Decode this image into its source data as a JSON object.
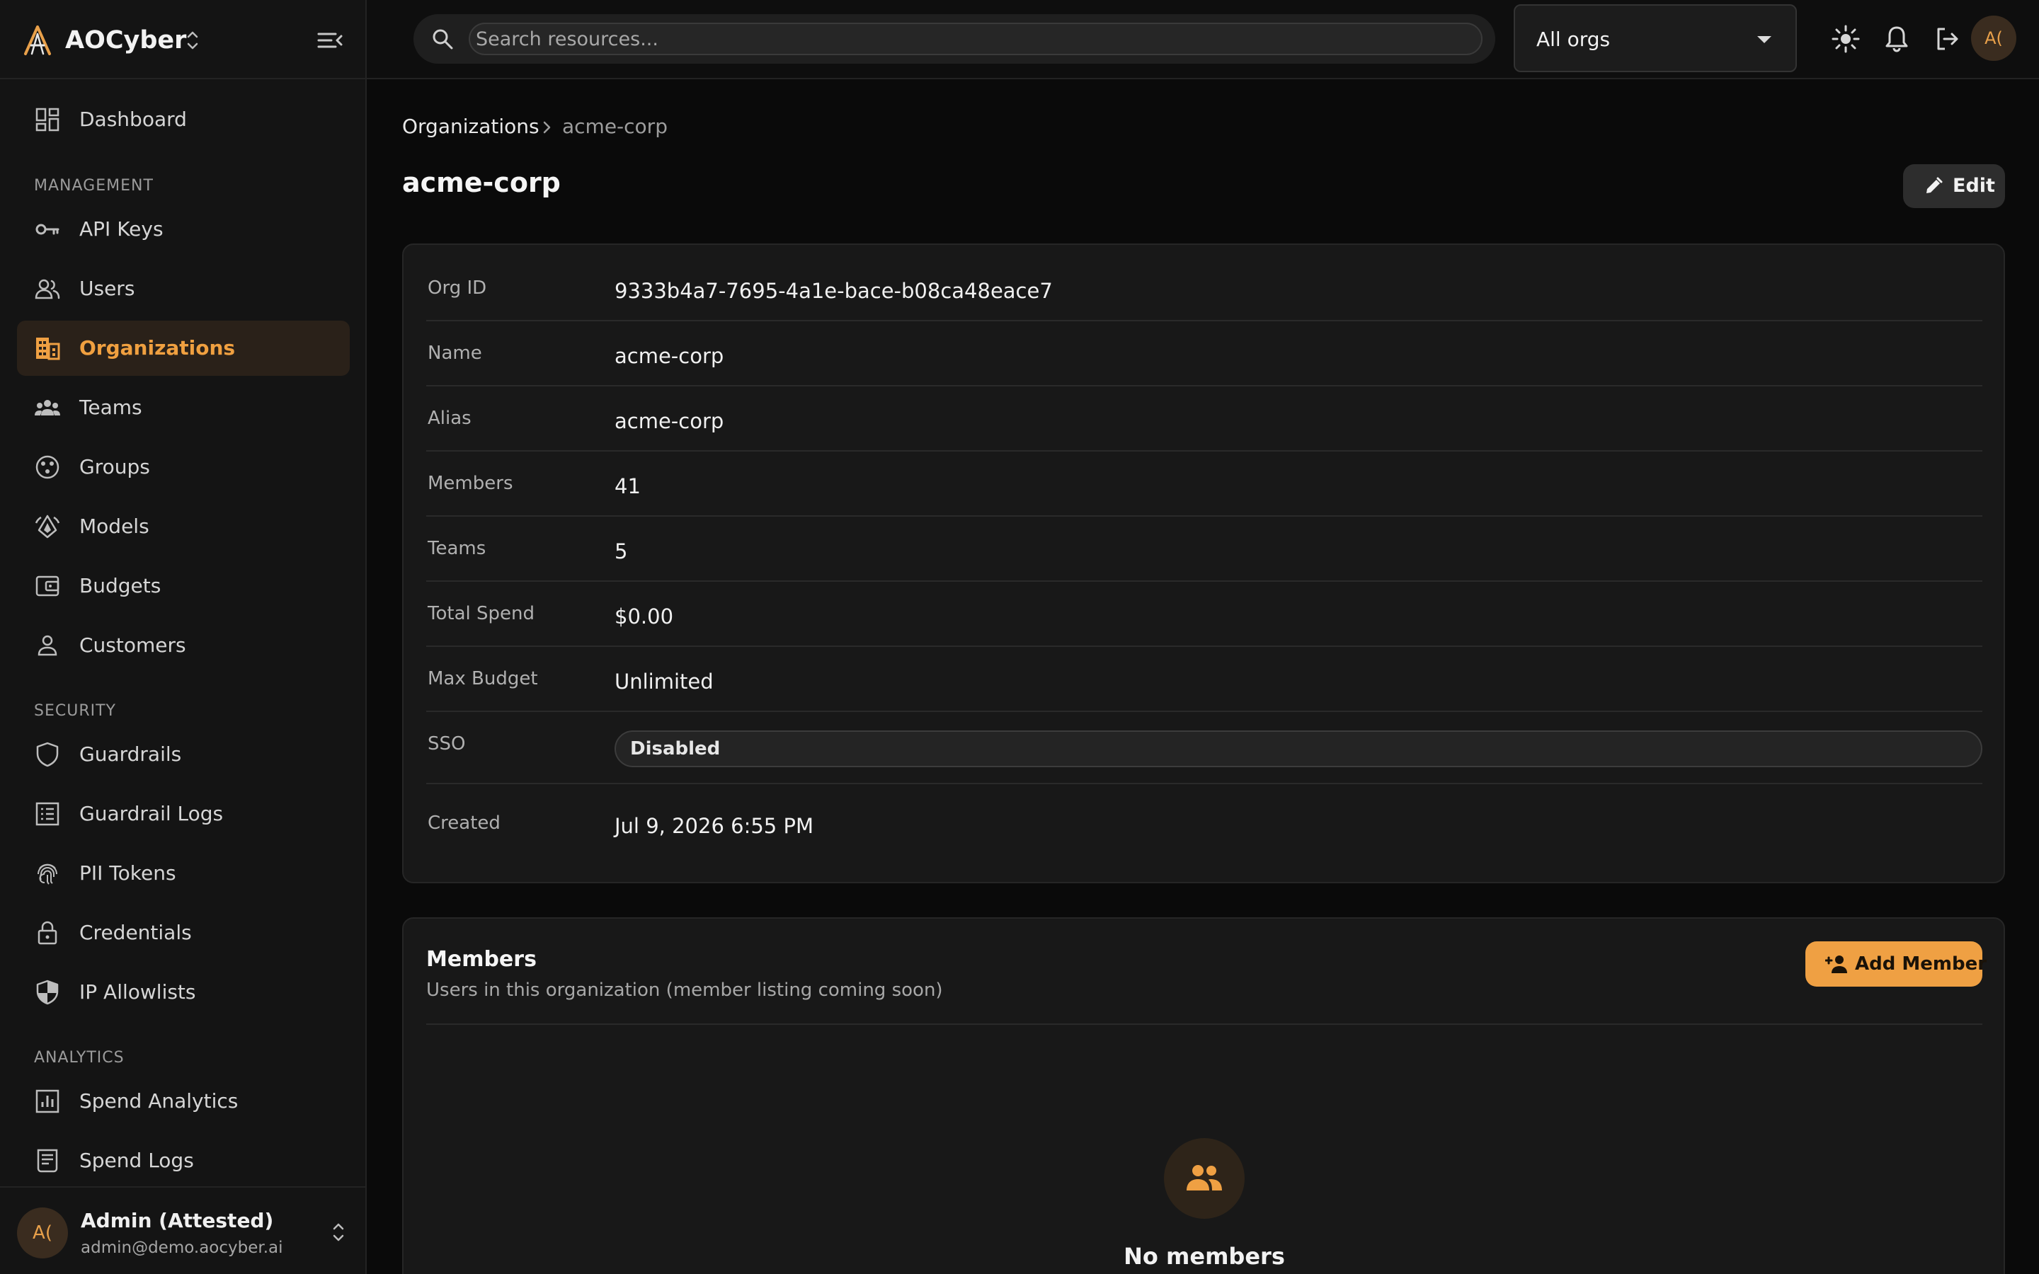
{
  "brand": {
    "name": "AOCyber"
  },
  "sidebar": {
    "dashboard": "Dashboard",
    "sections": {
      "management": "MANAGEMENT",
      "security": "SECURITY",
      "analytics": "ANALYTICS"
    },
    "items": {
      "api_keys": "API Keys",
      "users": "Users",
      "organizations": "Organizations",
      "teams": "Teams",
      "groups": "Groups",
      "models": "Models",
      "budgets": "Budgets",
      "customers": "Customers",
      "guardrails": "Guardrails",
      "guardrail_logs": "Guardrail Logs",
      "pii_tokens": "PII Tokens",
      "credentials": "Credentials",
      "ip_allowlists": "IP Allowlists",
      "spend_analytics": "Spend Analytics",
      "spend_logs": "Spend Logs"
    },
    "active": "organizations"
  },
  "user": {
    "initials": "A(",
    "name": "Admin (Attested)",
    "email": "admin@demo.aocyber.ai"
  },
  "header": {
    "search_placeholder": "Search resources...",
    "org_select": "All orgs",
    "avatar_initials": "A("
  },
  "breadcrumb": {
    "parent": "Organizations",
    "current": "acme-corp"
  },
  "page": {
    "title": "acme-corp",
    "edit_label": "Edit"
  },
  "details": [
    {
      "label": "Org ID",
      "value": "9333b4a7-7695-4a1e-bace-b08ca48eace7"
    },
    {
      "label": "Name",
      "value": "acme-corp"
    },
    {
      "label": "Alias",
      "value": "acme-corp"
    },
    {
      "label": "Members",
      "value": "41"
    },
    {
      "label": "Teams",
      "value": "5"
    },
    {
      "label": "Total Spend",
      "value": "$0.00"
    },
    {
      "label": "Max Budget",
      "value": "Unlimited"
    },
    {
      "label": "SSO",
      "value": "Disabled"
    },
    {
      "label": "Created",
      "value": "Jul 9, 2026 6:55 PM"
    }
  ],
  "members": {
    "title": "Members",
    "subtitle": "Users in this organization (member listing coming soon)",
    "add_label": "Add Member",
    "empty_title": "No members"
  },
  "colors": {
    "accent": "#efa043",
    "active_bg": "#2a2119",
    "background": "#0a0a0a",
    "card": "#181818"
  }
}
